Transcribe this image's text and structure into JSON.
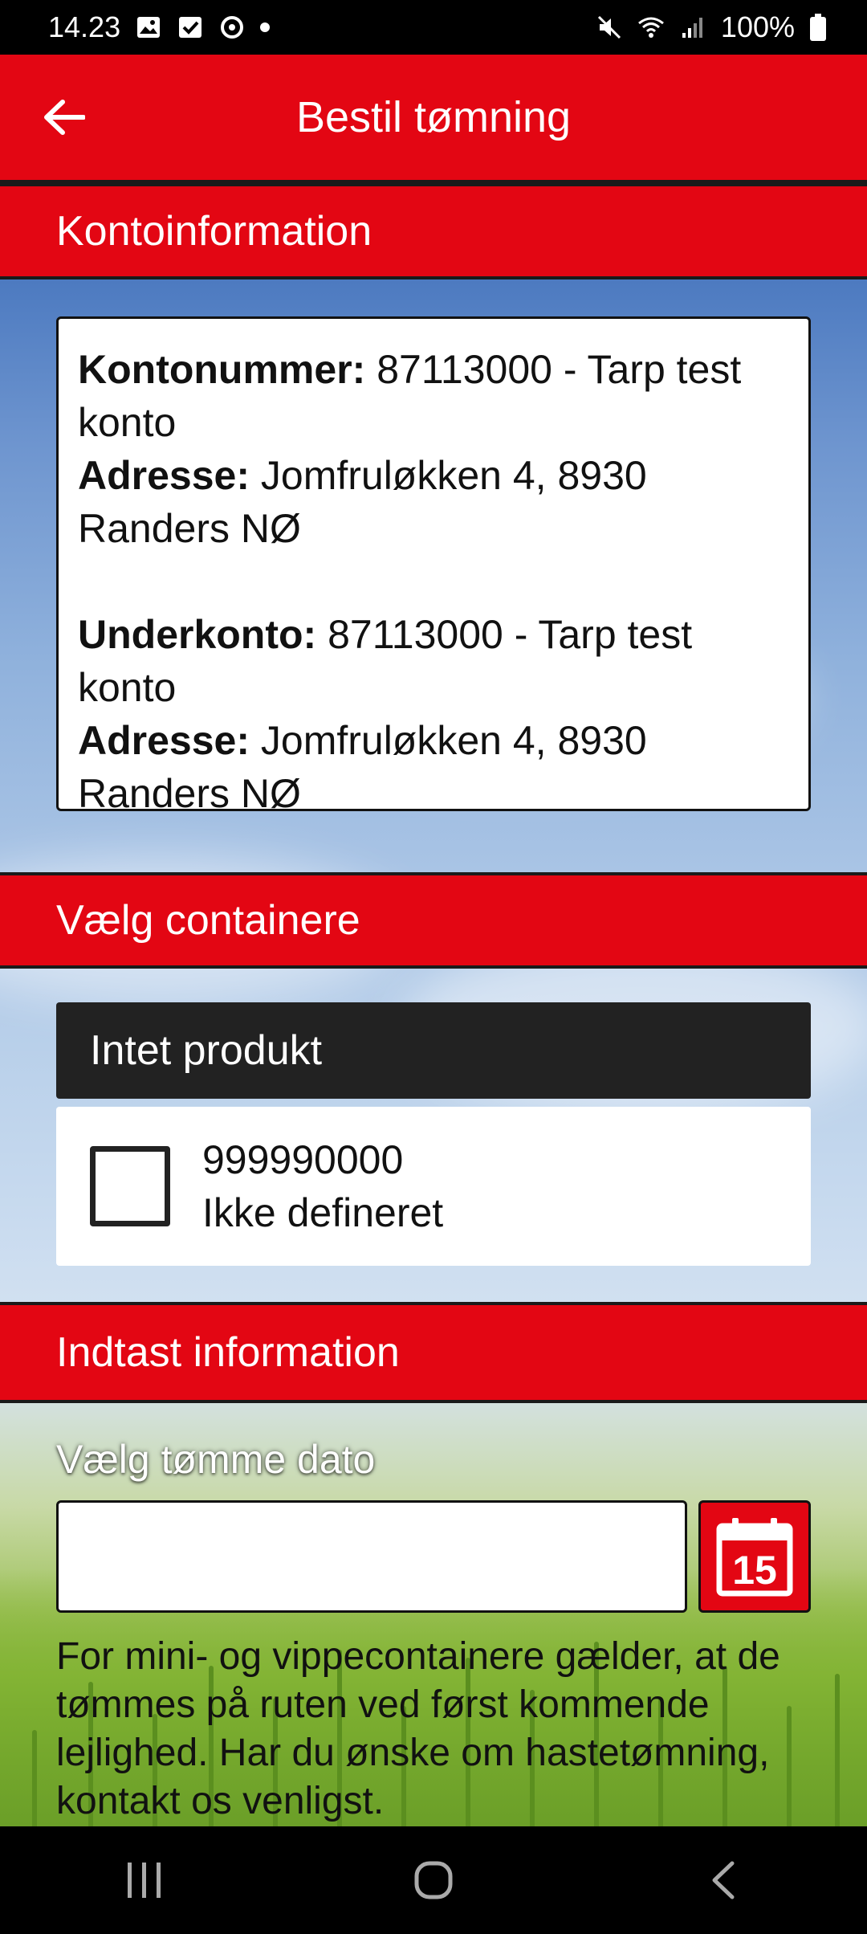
{
  "status_bar": {
    "time": "14.23",
    "battery": "100%"
  },
  "app_bar": {
    "title": "Bestil tømning"
  },
  "sections": {
    "account": "Kontoinformation",
    "containers": "Vælg containere",
    "info": "Indtast information"
  },
  "account": {
    "konto_label": "Kontonummer:",
    "konto_value": " 87113000 - Tarp test konto",
    "adresse_label": "Adresse:",
    "adresse_value": " Jomfruløkken 4, 8930 Randers NØ",
    "underkonto_label": "Underkonto:",
    "underkonto_value": " 87113000 - Tarp test konto",
    "adresse2_label": "Adresse:",
    "adresse2_value": " Jomfruløkken 4, 8930 Randers NØ"
  },
  "containers": {
    "group_title": "Intet produkt",
    "items": [
      {
        "number": "999990000",
        "description": "Ikke defineret",
        "checked": false
      }
    ]
  },
  "form": {
    "date_label": "Vælg tømme dato",
    "date_value": "",
    "calendar_day": "15",
    "note": "For mini- og vippecontainere gælder, at de tømmes på ruten ved først kommende lejlighed. Har du ønske om hastetømning, kontakt os venligst."
  },
  "colors": {
    "accent": "#e30613",
    "product_header": "#222222"
  }
}
